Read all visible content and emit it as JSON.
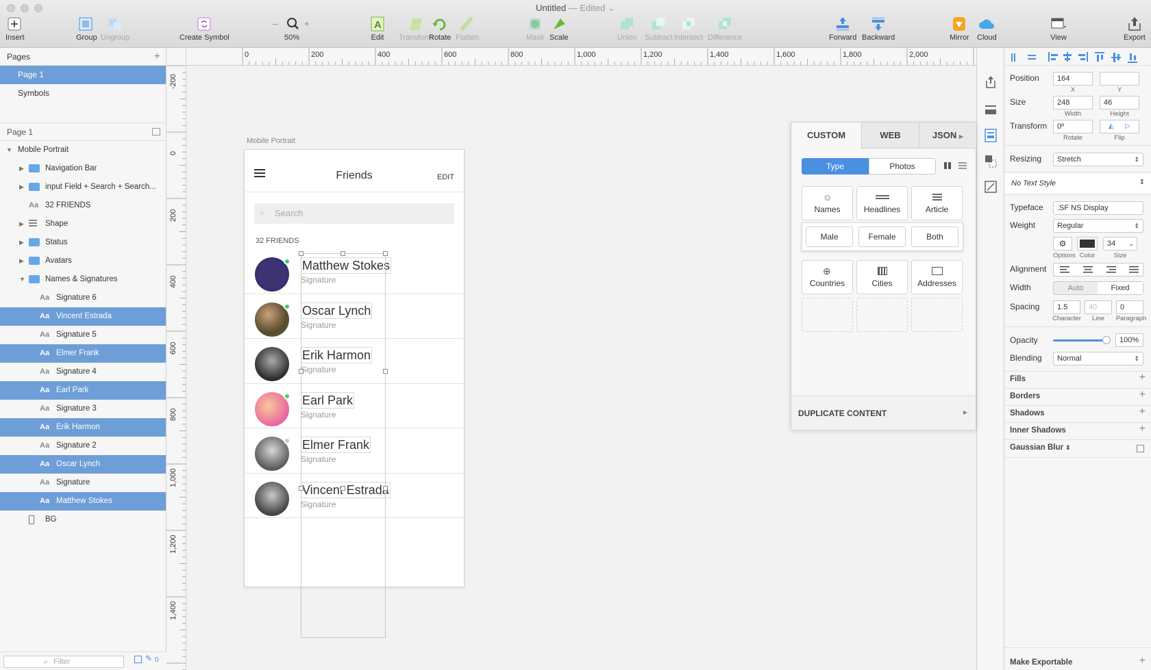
{
  "window": {
    "title": "Untitled",
    "status": "— Edited"
  },
  "toolbar": {
    "insert": "Insert",
    "group": "Group",
    "ungroup": "Ungroup",
    "create_symbol": "Create Symbol",
    "zoom": "50%",
    "edit": "Edit",
    "transform": "Transform",
    "rotate": "Rotate",
    "flatten": "Flatten",
    "mask": "Mask",
    "scale": "Scale",
    "union": "Union",
    "subtract": "Subtract",
    "intersect": "Intersect",
    "difference": "Difference",
    "forward": "Forward",
    "backward": "Backward",
    "mirror": "Mirror",
    "cloud": "Cloud",
    "view": "View",
    "export": "Export"
  },
  "pages": {
    "header": "Pages",
    "items": [
      "Page 1",
      "Symbols"
    ]
  },
  "layers": {
    "header": "Page 1",
    "artboard": "Mobile Portrait",
    "items": [
      {
        "label": "Navigation Bar"
      },
      {
        "label": "input Field + Search + Search..."
      },
      {
        "label": "32 FRIENDS"
      },
      {
        "label": "Shape"
      },
      {
        "label": "Status"
      },
      {
        "label": "Avatars"
      },
      {
        "label": "Names & Signatures"
      },
      {
        "label": "Signature 6"
      },
      {
        "label": "Vincent Estrada"
      },
      {
        "label": "Signature 5"
      },
      {
        "label": "Elmer Frank"
      },
      {
        "label": "Signature 4"
      },
      {
        "label": "Earl Park"
      },
      {
        "label": "Signature 3"
      },
      {
        "label": "Erik Harmon"
      },
      {
        "label": "Signature 2"
      },
      {
        "label": "Oscar Lynch"
      },
      {
        "label": "Signature"
      },
      {
        "label": "Matthew Stokes"
      },
      {
        "label": "BG"
      }
    ],
    "filter_placeholder": "Filter",
    "filter_count": "0"
  },
  "ruler": {
    "top": [
      "0",
      "200",
      "400",
      "600",
      "800",
      "1,000",
      "1,200",
      "1,400",
      "1,600",
      "1,800",
      "2,000"
    ],
    "left": [
      "-200",
      "0",
      "200",
      "400",
      "600",
      "800",
      "1,000",
      "1,200",
      "1,400"
    ]
  },
  "artboard": {
    "label": "Mobile Portrait",
    "title": "Friends",
    "edit": "EDIT",
    "search_placeholder": "Search",
    "count": "32 FRIENDS",
    "friends": [
      {
        "name": "Matthew Stokes",
        "sig": "Signature",
        "status": "#3ed06b"
      },
      {
        "name": "Oscar Lynch",
        "sig": "Signature",
        "status": "#3ed06b"
      },
      {
        "name": "Erik Harmon",
        "sig": "Signature",
        "status": ""
      },
      {
        "name": "Earl Park",
        "sig": "Signature",
        "status": "#3ed06b"
      },
      {
        "name": "Elmer Frank",
        "sig": "Signature",
        "status": "#c8c8c8"
      },
      {
        "name": "Vincent Estrada",
        "sig": "Signature",
        "status": ""
      }
    ]
  },
  "plugin": {
    "tabs": [
      "CUSTOM",
      "WEB",
      "JSON"
    ],
    "segments": [
      "Type",
      "Photos"
    ],
    "row1": [
      "Names",
      "Headlines",
      "Article"
    ],
    "sub": [
      "Male",
      "Female",
      "Both"
    ],
    "row3": [
      "Countries",
      "Cities",
      "Addresses"
    ],
    "duplicate": "DUPLICATE CONTENT"
  },
  "inspector": {
    "position_label": "Position",
    "x": "164",
    "y": "",
    "x_label": "X",
    "y_label": "Y",
    "size_label": "Size",
    "width": "248",
    "height": "46",
    "width_label": "Width",
    "height_label": "Height",
    "transform_label": "Transform",
    "rotate": "0º",
    "rotate_label": "Rotate",
    "flip_label": "Flip",
    "resizing_label": "Resizing",
    "resizing": "Stretch",
    "text_style": "No Text Style",
    "typeface_label": "Typeface",
    "typeface": ".SF NS Display",
    "weight_label": "Weight",
    "weight": "Regular",
    "options_label": "Options",
    "color_label": "Color",
    "size_sub_label": "Size",
    "font_size": "34",
    "alignment_label": "Alignment",
    "width2_label": "Width",
    "width_auto": "Auto",
    "width_fixed": "Fixed",
    "spacing_label": "Spacing",
    "character": "1.5",
    "line": "40",
    "paragraph": "0",
    "character_label": "Character",
    "line_label": "Line",
    "paragraph_label": "Paragraph",
    "opacity_label": "Opacity",
    "opacity": "100%",
    "blending_label": "Blending",
    "blending": "Normal",
    "fills": "Fills",
    "borders": "Borders",
    "shadows": "Shadows",
    "inner_shadows": "Inner Shadows",
    "gaussian_blur": "Gaussian Blur",
    "make_exportable": "Make Exportable"
  },
  "colors": {
    "selection": "#6e9ed8",
    "accent": "#4a90e2",
    "online": "#3ed06b"
  }
}
